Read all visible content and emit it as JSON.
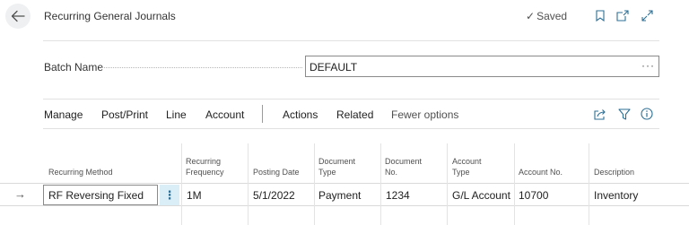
{
  "header": {
    "title": "Recurring General Journals",
    "saved_label": "Saved",
    "icons": [
      "back-arrow-icon",
      "check-icon",
      "bookmark-icon",
      "open-new-window-icon",
      "expand-icon"
    ]
  },
  "batch": {
    "label": "Batch Name",
    "value": "DEFAULT",
    "more": "···"
  },
  "actions": {
    "manage": "Manage",
    "post_print": "Post/Print",
    "line": "Line",
    "account": "Account",
    "actions": "Actions",
    "related": "Related",
    "fewer_options": "Fewer options",
    "icons": [
      "share-icon",
      "filter-icon",
      "info-icon"
    ]
  },
  "grid": {
    "columns": [
      {
        "line1": "Recurring Method",
        "line2": ""
      },
      {
        "line1": "Recurring",
        "line2": "Frequency"
      },
      {
        "line1": "Posting Date",
        "line2": ""
      },
      {
        "line1": "Document",
        "line2": "Type"
      },
      {
        "line1": "Document",
        "line2": "No."
      },
      {
        "line1": "Account",
        "line2": "Type"
      },
      {
        "line1": "Account No.",
        "line2": ""
      },
      {
        "line1": "Description",
        "line2": ""
      }
    ],
    "row": {
      "recurring_method": "RF Reversing Fixed",
      "menu": "⋮",
      "recurring_frequency": "1M",
      "posting_date": "5/1/2022",
      "document_type": "Payment",
      "document_no": "1234",
      "account_type": "G/L Account",
      "account_no": "10700",
      "description": "Inventory"
    },
    "row_indicator": "→"
  },
  "colors": {
    "accent": "#2d6f95",
    "selected_menu_bg": "#d9eef7",
    "border": "#8a8a8a"
  }
}
